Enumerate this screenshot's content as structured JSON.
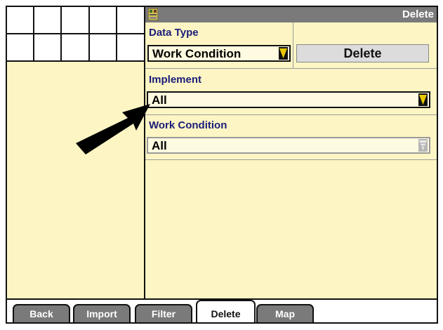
{
  "header": {
    "title": "Delete",
    "device_icon": "hard-drive-icon"
  },
  "data_type": {
    "label": "Data Type",
    "value": "Work Condition",
    "delete_label": "Delete"
  },
  "implement": {
    "label": "Implement",
    "value": "All"
  },
  "work_condition": {
    "label": "Work Condition",
    "value": "All"
  },
  "tabs": [
    {
      "label": "Back",
      "active": false
    },
    {
      "label": "Import",
      "active": false
    },
    {
      "label": "Filter",
      "active": false
    },
    {
      "label": "Delete",
      "active": true
    },
    {
      "label": "Map",
      "active": false
    }
  ],
  "colors": {
    "panel": "#fdf6c4",
    "title_bar": "#7a7a7a",
    "label_text": "#1b1c7a",
    "tab_inactive": "#7a7a7a"
  }
}
